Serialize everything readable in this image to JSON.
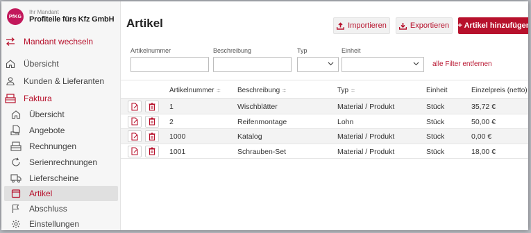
{
  "brand": {
    "logo": "PfKG",
    "caption": "Ihr Mandant",
    "name": "Profiteile fürs Kfz GmbH"
  },
  "sidebar": {
    "switch_label": "Mandant wechseln",
    "items": [
      {
        "label": "Übersicht",
        "icon": "home-icon"
      },
      {
        "label": "Kunden & Lieferanten",
        "icon": "user-icon"
      },
      {
        "label": "Faktura",
        "icon": "register-icon"
      },
      {
        "label": "Übersicht",
        "icon": "home-icon"
      },
      {
        "label": "Angebote",
        "icon": "offer-icon"
      },
      {
        "label": "Rechnungen",
        "icon": "invoice-icon"
      },
      {
        "label": "Serienrechnungen",
        "icon": "recurring-icon"
      },
      {
        "label": "Lieferscheine",
        "icon": "delivery-icon"
      },
      {
        "label": "Artikel",
        "icon": "article-icon"
      },
      {
        "label": "Abschluss",
        "icon": "flag-icon"
      },
      {
        "label": "Einstellungen",
        "icon": "gear-icon"
      }
    ]
  },
  "header": {
    "title": "Artikel",
    "import_label": "Importieren",
    "export_label": "Exportieren",
    "add_label": "+ Artikel hinzufügen"
  },
  "filters": {
    "number_label": "Artikelnummer",
    "number_value": "",
    "description_label": "Beschreibung",
    "description_value": "",
    "type_label": "Typ",
    "type_value": "",
    "unit_label": "Einheit",
    "unit_value": "",
    "reset_label": "alle Filter entfernen"
  },
  "table": {
    "columns": [
      "Artikelnummer",
      "Beschreibung",
      "Typ",
      "Einheit",
      "Einzelpreis (netto)"
    ],
    "rows": [
      {
        "number": "1",
        "description": "Wischblätter",
        "type": "Material / Produkt",
        "unit": "Stück",
        "price": "35,72 €"
      },
      {
        "number": "2",
        "description": "Reifenmontage",
        "type": "Lohn",
        "unit": "Stück",
        "price": "50,00 €"
      },
      {
        "number": "1000",
        "description": "Katalog",
        "type": "Material / Produkt",
        "unit": "Stück",
        "price": "0,00 €"
      },
      {
        "number": "1001",
        "description": "Schrauben-Set",
        "type": "Material / Produkt",
        "unit": "Stück",
        "price": "18,00 €"
      }
    ]
  },
  "colors": {
    "accent": "#b7112c",
    "logo": "#c2185b"
  }
}
